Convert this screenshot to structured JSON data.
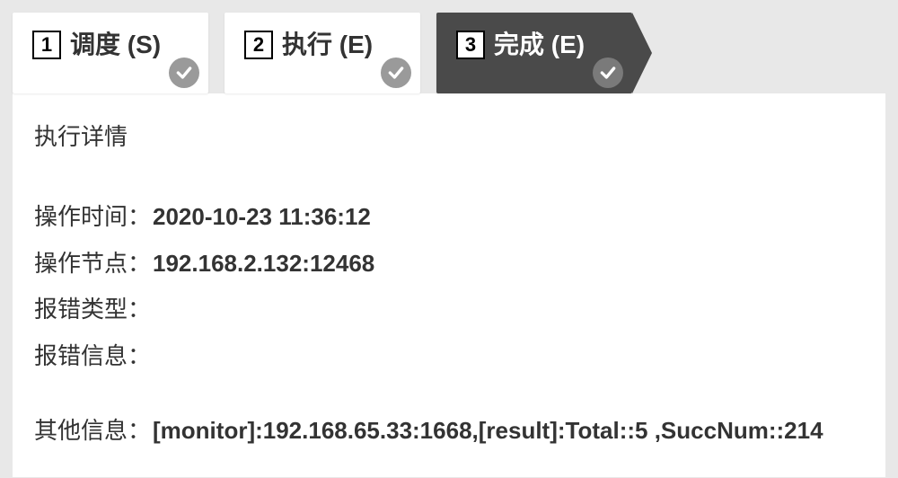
{
  "tabs": [
    {
      "num": "1",
      "label": "调度 (S)",
      "active": false
    },
    {
      "num": "2",
      "label": "执行 (E)",
      "active": false
    },
    {
      "num": "3",
      "label": "完成 (E)",
      "active": true
    }
  ],
  "section_title": "执行详情",
  "details": {
    "op_time_label": "操作时间：",
    "op_time_value": "2020-10-23 11:36:12",
    "op_node_label": "操作节点：",
    "op_node_value": "192.168.2.132:12468",
    "err_type_label": "报错类型：",
    "err_type_value": "",
    "err_info_label": "报错信息：",
    "err_info_value": "",
    "other_label": "其他信息：",
    "other_value": "[monitor]:192.168.65.33:1668,[result]:Total::5 ,SuccNum::214"
  }
}
